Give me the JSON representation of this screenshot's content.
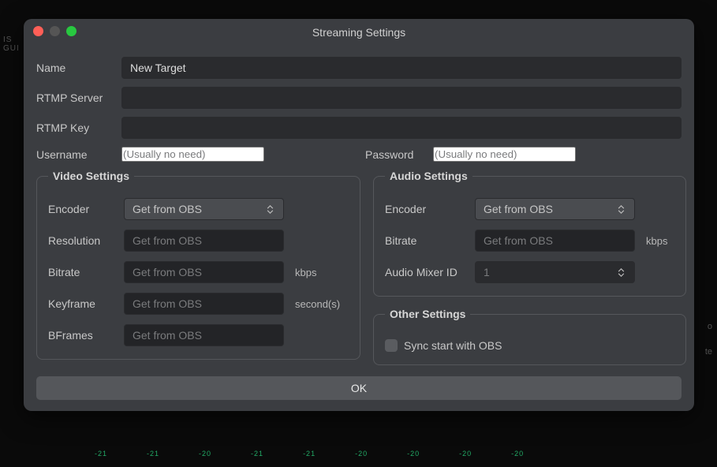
{
  "dialog": {
    "title": "Streaming Settings",
    "name_label": "Name",
    "name_value": "New Target",
    "rtmp_server_label": "RTMP Server",
    "rtmp_server_value": "",
    "rtmp_key_label": "RTMP Key",
    "rtmp_key_value": "",
    "username_label": "Username",
    "username_placeholder": "(Usually no need)",
    "password_label": "Password",
    "password_placeholder": "(Usually no need)"
  },
  "video": {
    "legend": "Video Settings",
    "encoder_label": "Encoder",
    "encoder_value": "Get from OBS",
    "resolution_label": "Resolution",
    "resolution_placeholder": "Get from OBS",
    "bitrate_label": "Bitrate",
    "bitrate_placeholder": "Get from OBS",
    "bitrate_unit": "kbps",
    "keyframe_label": "Keyframe",
    "keyframe_placeholder": "Get from OBS",
    "keyframe_unit": "second(s)",
    "bframes_label": "BFrames",
    "bframes_placeholder": "Get from OBS"
  },
  "audio": {
    "legend": "Audio Settings",
    "encoder_label": "Encoder",
    "encoder_value": "Get from OBS",
    "bitrate_label": "Bitrate",
    "bitrate_placeholder": "Get from OBS",
    "bitrate_unit": "kbps",
    "mixer_label": "Audio Mixer ID",
    "mixer_value": "1"
  },
  "other": {
    "legend": "Other Settings",
    "sync_label": "Sync start with OBS",
    "sync_checked": false
  },
  "footer": {
    "ok_label": "OK"
  }
}
